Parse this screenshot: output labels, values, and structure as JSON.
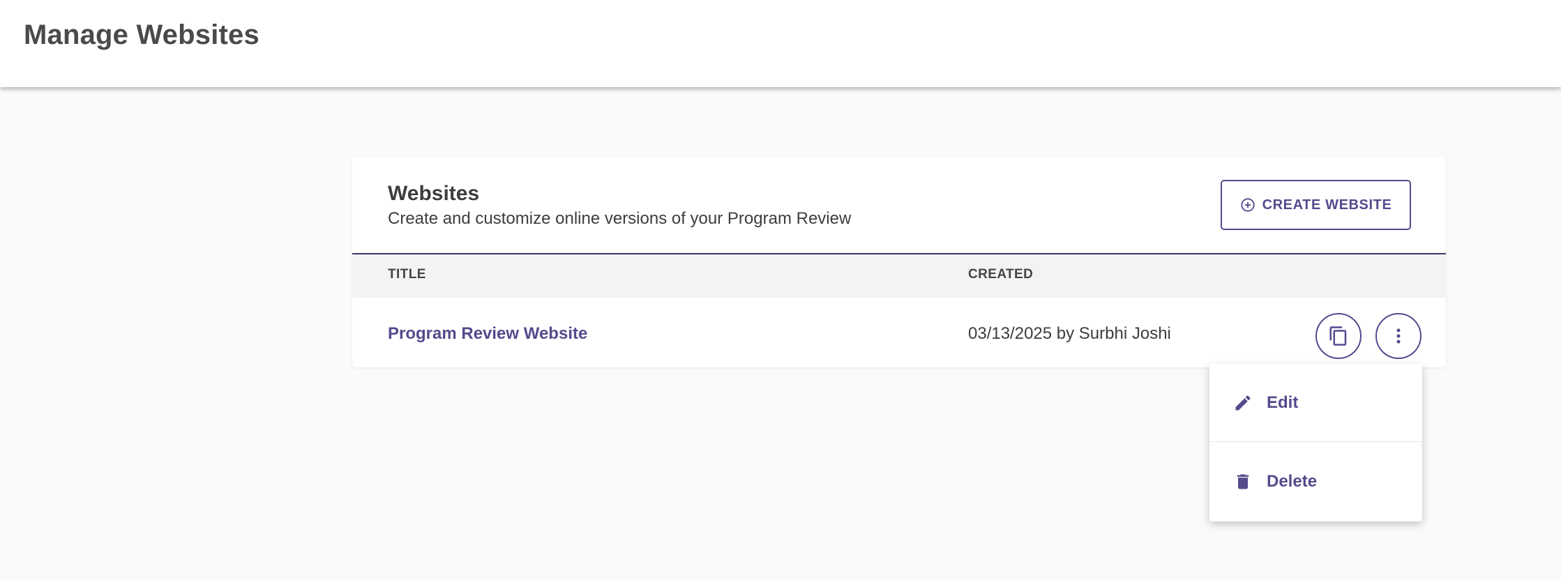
{
  "header": {
    "title": "Manage Websites"
  },
  "card": {
    "title": "Websites",
    "subtitle": "Create and customize online versions of your Program Review",
    "create_button": {
      "label": "CREATE WEBSITE",
      "icon": "plus-circle-icon"
    }
  },
  "table": {
    "columns": [
      "TITLE",
      "CREATED"
    ],
    "rows": [
      {
        "title": "Program Review Website",
        "created": "03/13/2025 by Surbhi Joshi",
        "actions": [
          "copy-icon",
          "more-vert-icon"
        ]
      }
    ]
  },
  "menu": {
    "items": [
      {
        "label": "Edit",
        "icon": "pencil-icon"
      },
      {
        "label": "Delete",
        "icon": "trash-icon"
      }
    ]
  },
  "colors": {
    "accent": "#554a8c",
    "table_header_border": "#3c3566",
    "page_background": "#fafafa"
  }
}
